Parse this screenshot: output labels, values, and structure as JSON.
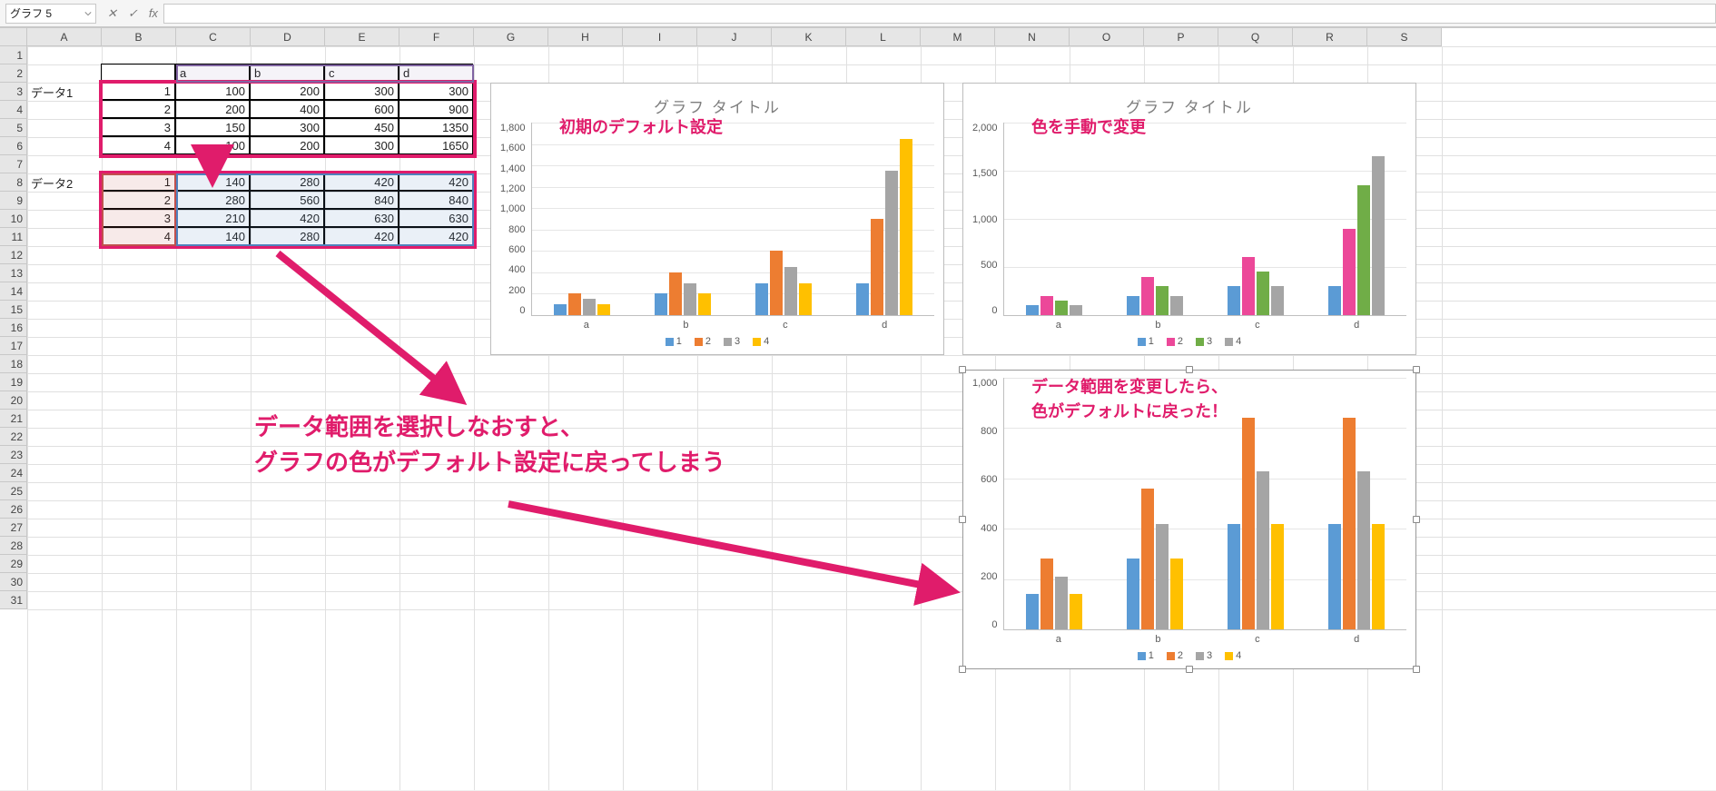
{
  "namebox": "グラフ 5",
  "fx_label": "fx",
  "columns": [
    "A",
    "B",
    "C",
    "D",
    "E",
    "F",
    "G",
    "H",
    "I",
    "J",
    "K",
    "L",
    "M",
    "N",
    "O",
    "P",
    "Q",
    "R",
    "S"
  ],
  "rows": 31,
  "labels": {
    "data1": "データ1",
    "data2": "データ2",
    "headers": [
      "a",
      "b",
      "c",
      "d"
    ]
  },
  "table1": {
    "idx": [
      1,
      2,
      3,
      4
    ],
    "rows": [
      [
        100,
        200,
        300,
        300
      ],
      [
        200,
        400,
        600,
        900
      ],
      [
        150,
        300,
        450,
        1350
      ],
      [
        100,
        200,
        300,
        1650
      ]
    ]
  },
  "table2": {
    "idx": [
      1,
      2,
      3,
      4
    ],
    "rows": [
      [
        140,
        280,
        420,
        420
      ],
      [
        280,
        560,
        840,
        840
      ],
      [
        210,
        420,
        630,
        630
      ],
      [
        140,
        280,
        420,
        420
      ]
    ]
  },
  "chart_data": [
    {
      "type": "bar",
      "title": "グラフ タイトル",
      "categories": [
        "a",
        "b",
        "c",
        "d"
      ],
      "series": [
        {
          "name": "1",
          "values": [
            100,
            200,
            300,
            300
          ],
          "color": "#5b9bd5"
        },
        {
          "name": "2",
          "values": [
            200,
            400,
            600,
            900
          ],
          "color": "#ed7d31"
        },
        {
          "name": "3",
          "values": [
            150,
            300,
            450,
            1350
          ],
          "color": "#a5a5a5"
        },
        {
          "name": "4",
          "values": [
            100,
            200,
            300,
            1650
          ],
          "color": "#ffc000"
        }
      ],
      "ylim": [
        0,
        1800
      ],
      "ystep": 200,
      "note": "初期のデフォルト設定"
    },
    {
      "type": "bar",
      "title": "グラフ タイトル",
      "categories": [
        "a",
        "b",
        "c",
        "d"
      ],
      "series": [
        {
          "name": "1",
          "values": [
            100,
            200,
            300,
            300
          ],
          "color": "#5b9bd5"
        },
        {
          "name": "2",
          "values": [
            200,
            400,
            600,
            900
          ],
          "color": "#ec4899"
        },
        {
          "name": "3",
          "values": [
            150,
            300,
            450,
            1350
          ],
          "color": "#70ad47"
        },
        {
          "name": "4",
          "values": [
            100,
            200,
            300,
            1650
          ],
          "color": "#a5a5a5"
        }
      ],
      "ylim": [
        0,
        2000
      ],
      "ystep": 500,
      "note": "色を手動で変更"
    },
    {
      "type": "bar",
      "title": "",
      "categories": [
        "a",
        "b",
        "c",
        "d"
      ],
      "series": [
        {
          "name": "1",
          "values": [
            140,
            280,
            420,
            420
          ],
          "color": "#5b9bd5"
        },
        {
          "name": "2",
          "values": [
            280,
            560,
            840,
            840
          ],
          "color": "#ed7d31"
        },
        {
          "name": "3",
          "values": [
            210,
            420,
            630,
            630
          ],
          "color": "#a5a5a5"
        },
        {
          "name": "4",
          "values": [
            140,
            280,
            420,
            420
          ],
          "color": "#ffc000"
        }
      ],
      "ylim": [
        0,
        1000
      ],
      "ystep": 200,
      "note": "データ範囲を変更したら、\n色がデフォルトに戻った！"
    }
  ],
  "big_note": "データ範囲を選択しなおすと、\nグラフの色がデフォルト設定に戻ってしまう"
}
